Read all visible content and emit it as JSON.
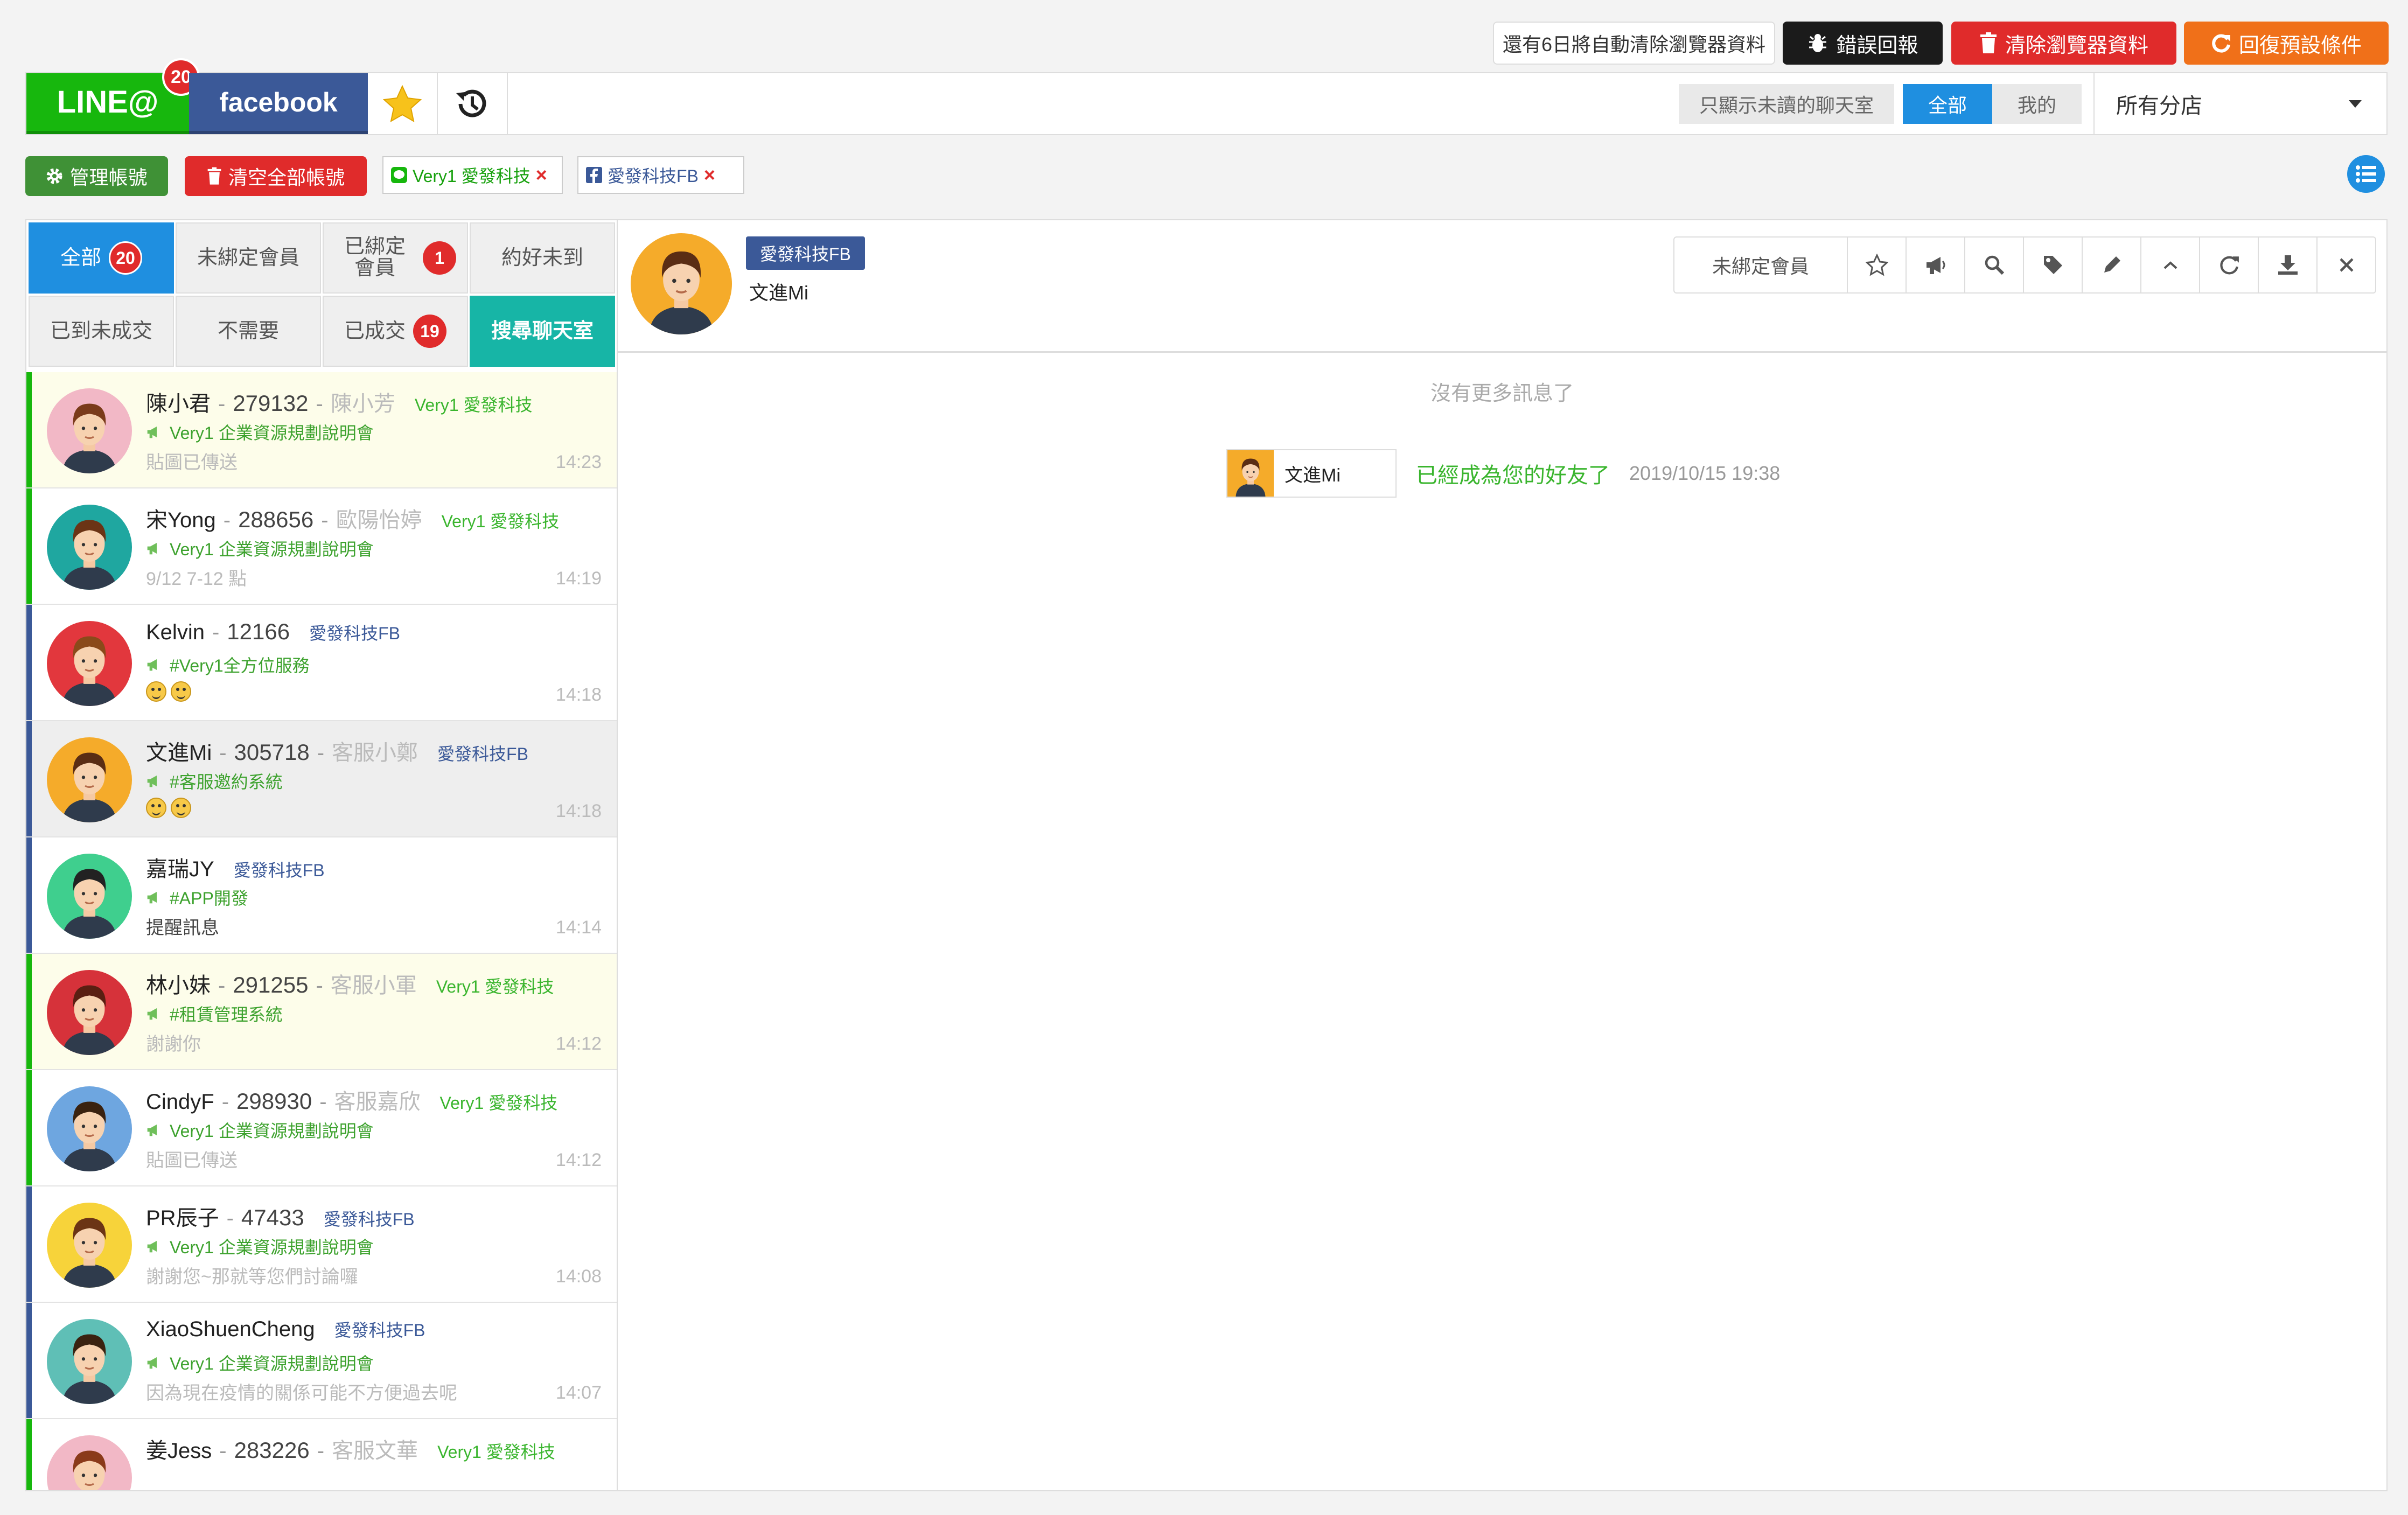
{
  "top_buttons": {
    "notice": "還有6日將自動清除瀏覽器資料",
    "report": "錯誤回報",
    "clear_browser": "清除瀏覽器資料",
    "restore": "回復預設條件"
  },
  "channels": {
    "line": "LINE@",
    "line_badge": "20",
    "facebook": "facebook"
  },
  "filters": {
    "unread_only": "只顯示未讀的聊天室",
    "all": "全部",
    "mine": "我的",
    "store": "所有分店"
  },
  "accounts": {
    "manage": "管理帳號",
    "clear_all": "清空全部帳號",
    "chips": [
      {
        "label": "Very1 愛發科技",
        "type": "line"
      },
      {
        "label": "愛發科技FB",
        "type": "facebook"
      }
    ]
  },
  "status_tabs": [
    {
      "label": "全部",
      "badge": "20"
    },
    {
      "label": "未綁定會員",
      "badge": ""
    },
    {
      "label": "已綁定會員",
      "badge": "1"
    },
    {
      "label": "約好未到",
      "badge": ""
    },
    {
      "label": "已到未成交",
      "badge": ""
    },
    {
      "label": "不需要",
      "badge": ""
    },
    {
      "label": "已成交",
      "badge": "19"
    },
    {
      "label": "搜尋聊天室",
      "badge": ""
    }
  ],
  "chats": [
    {
      "name": "陳小君",
      "id": "279132",
      "service": "陳小芳",
      "account": "Very1 愛發科技",
      "tag": "Very1 企業資源規劃說明會",
      "preview": "貼圖已傳送",
      "time": "14:23",
      "channel": "line",
      "avatar_bg": "#f2b8c6",
      "hair": "#7a3b1a"
    },
    {
      "name": "宋Yong",
      "id": "288656",
      "service": "歐陽怡婷",
      "account": "Very1 愛發科技",
      "tag": "Very1 企業資源規劃說明會",
      "preview": "9/12 7-12 點",
      "time": "14:19",
      "channel": "line",
      "avatar_bg": "#1fa7a0",
      "hair": "#6b3415"
    },
    {
      "name": "Kelvin",
      "id": "12166",
      "service": "",
      "account": "愛發科技FB",
      "tag": "#Very1全方位服務",
      "preview": "emoji",
      "time": "14:18",
      "channel": "facebook",
      "avatar_bg": "#e2373d",
      "hair": "#8a4a1a"
    },
    {
      "name": "文進Mi",
      "id": "305718",
      "service": "客服小鄭",
      "account": "愛發科技FB",
      "tag": "#客服邀約系統",
      "preview": "emoji",
      "time": "14:18",
      "channel": "facebook",
      "avatar_bg": "#f5ab2a",
      "hair": "#5a2d14"
    },
    {
      "name": "嘉瑞JY",
      "id": "",
      "service": "",
      "account": "愛發科技FB",
      "tag": "#APP開發",
      "preview": "提醒訊息",
      "time": "14:14",
      "channel": "facebook",
      "avatar_bg": "#3fcf8e",
      "hair": "#222222"
    },
    {
      "name": "林小妹",
      "id": "291255",
      "service": "客服小軍",
      "account": "Very1 愛發科技",
      "tag": "#租賃管理系統",
      "preview": "謝謝你",
      "time": "14:12",
      "channel": "line",
      "avatar_bg": "#d6323a",
      "hair": "#5a1f12"
    },
    {
      "name": "CindyF",
      "id": "298930",
      "service": "客服嘉欣",
      "account": "Very1 愛發科技",
      "tag": "Very1 企業資源規劃說明會",
      "preview": "貼圖已傳送",
      "time": "14:12",
      "channel": "line",
      "avatar_bg": "#6ea6e0",
      "hair": "#3a2210"
    },
    {
      "name": "PR辰子",
      "id": "47433",
      "service": "",
      "account": "愛發科技FB",
      "tag": "Very1 企業資源規劃說明會",
      "preview": "謝謝您~那就等您們討論囉",
      "time": "14:08",
      "channel": "facebook",
      "avatar_bg": "#f7d33a",
      "hair": "#6b3415"
    },
    {
      "name": "XiaoShuenCheng",
      "id": "",
      "service": "",
      "account": "愛發科技FB",
      "tag": "Very1 企業資源規劃說明會",
      "preview": "因為現在疫情的關係可能不方便過去呢",
      "time": "14:07",
      "channel": "facebook",
      "avatar_bg": "#5fbfb6",
      "hair": "#3a2210"
    },
    {
      "name": "姜Jess",
      "id": "283226",
      "service": "客服文華",
      "account": "Very1 愛發科技",
      "tag": "",
      "preview": "",
      "time": "",
      "channel": "line",
      "avatar_bg": "#f2b8c6",
      "hair": "#8a3a1a"
    }
  ],
  "conversation": {
    "account_tag": "愛發科技FB",
    "name": "文進Mi",
    "member_status": "未綁定會員",
    "no_more": "沒有更多訊息了",
    "system_name": "文進Mi",
    "system_text": "已經成為您的好友了",
    "system_time": "2019/10/15 19:38"
  },
  "colors": {
    "line_green": "#17b70d",
    "facebook_blue": "#3b5998",
    "accent_blue": "#1f8fe0",
    "danger_red": "#e02b2b",
    "orange": "#f07019"
  }
}
